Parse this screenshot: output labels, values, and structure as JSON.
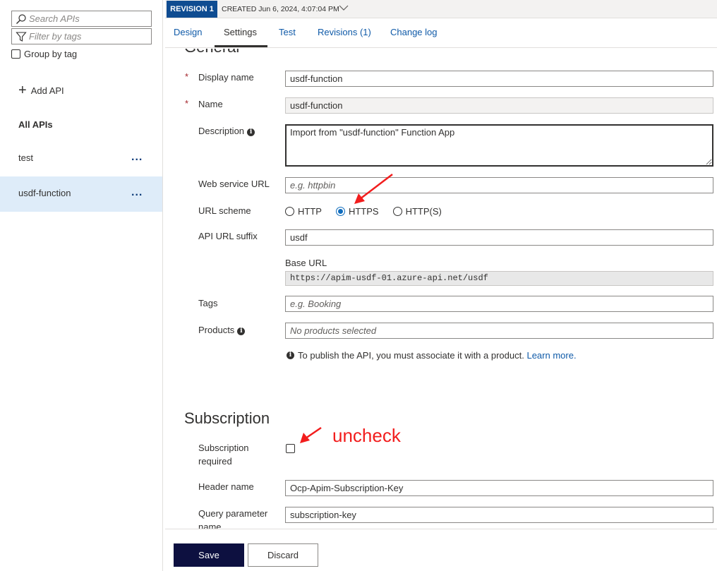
{
  "sidebar": {
    "search_placeholder": "Search APIs",
    "filter_placeholder": "Filter by tags",
    "group_by_tag": "Group by tag",
    "add_api": "Add API",
    "all_apis": "All APIs",
    "apis": [
      {
        "label": "test",
        "more": "..."
      },
      {
        "label": "usdf-function",
        "more": "..."
      }
    ]
  },
  "revision": {
    "badge": "REVISION 1",
    "created": "CREATED Jun 6, 2024, 4:07:04 PM"
  },
  "tabs": [
    {
      "label": "Design"
    },
    {
      "label": "Settings"
    },
    {
      "label": "Test"
    },
    {
      "label": "Revisions (1)"
    },
    {
      "label": "Change log"
    }
  ],
  "general": {
    "title": "General",
    "display_name_label": "Display name",
    "display_name_value": "usdf-function",
    "name_label": "Name",
    "name_value": "usdf-function",
    "description_label": "Description",
    "description_value": "Import from \"usdf-function\" Function App",
    "web_service_url_label": "Web service URL",
    "web_service_url_placeholder": "e.g. httpbin",
    "url_scheme_label": "URL scheme",
    "url_scheme_options": [
      "HTTP",
      "HTTPS",
      "HTTP(S)"
    ],
    "url_scheme_selected": "HTTPS",
    "api_url_suffix_label": "API URL suffix",
    "api_url_suffix_value": "usdf",
    "base_url_label": "Base URL",
    "base_url_value": "https://apim-usdf-01.azure-api.net/usdf",
    "tags_label": "Tags",
    "tags_placeholder": "e.g. Booking",
    "products_label": "Products",
    "products_placeholder": "No products selected",
    "publish_note": "To publish the API, you must associate it with a product.",
    "learn_more": "Learn more."
  },
  "subscription": {
    "title": "Subscription",
    "required_label_line1": "Subscription",
    "required_label_line2": "required",
    "required_checked": false,
    "header_name_label": "Header name",
    "header_name_value": "Ocp-Apim-Subscription-Key",
    "query_param_label": "Query parameter name",
    "query_param_value": "subscription-key"
  },
  "footer": {
    "save": "Save",
    "discard": "Discard"
  },
  "annotation": {
    "text": "uncheck",
    "color": "#f21d1d"
  },
  "colors": {
    "accent": "#0f6cbd",
    "revision_badge": "#0f4c91",
    "save_button": "#0d1040",
    "link": "#0f5aa8",
    "selected_item": "#deecf9"
  }
}
